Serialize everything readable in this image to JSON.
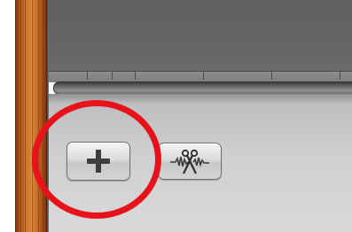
{
  "toolbar": {
    "buttons": [
      {
        "id": "add",
        "icon": "plus-icon",
        "tooltip": ""
      },
      {
        "id": "split",
        "icon": "scissors-waveform-icon",
        "tooltip": ""
      }
    ]
  },
  "annotation": {
    "shape": "circle",
    "color": "#e8131a",
    "target": "add-button"
  },
  "colors": {
    "wood": "#c8732c",
    "track_area": "#636465",
    "toolbar": "#cfd0d1",
    "annotation": "#e8131a"
  }
}
